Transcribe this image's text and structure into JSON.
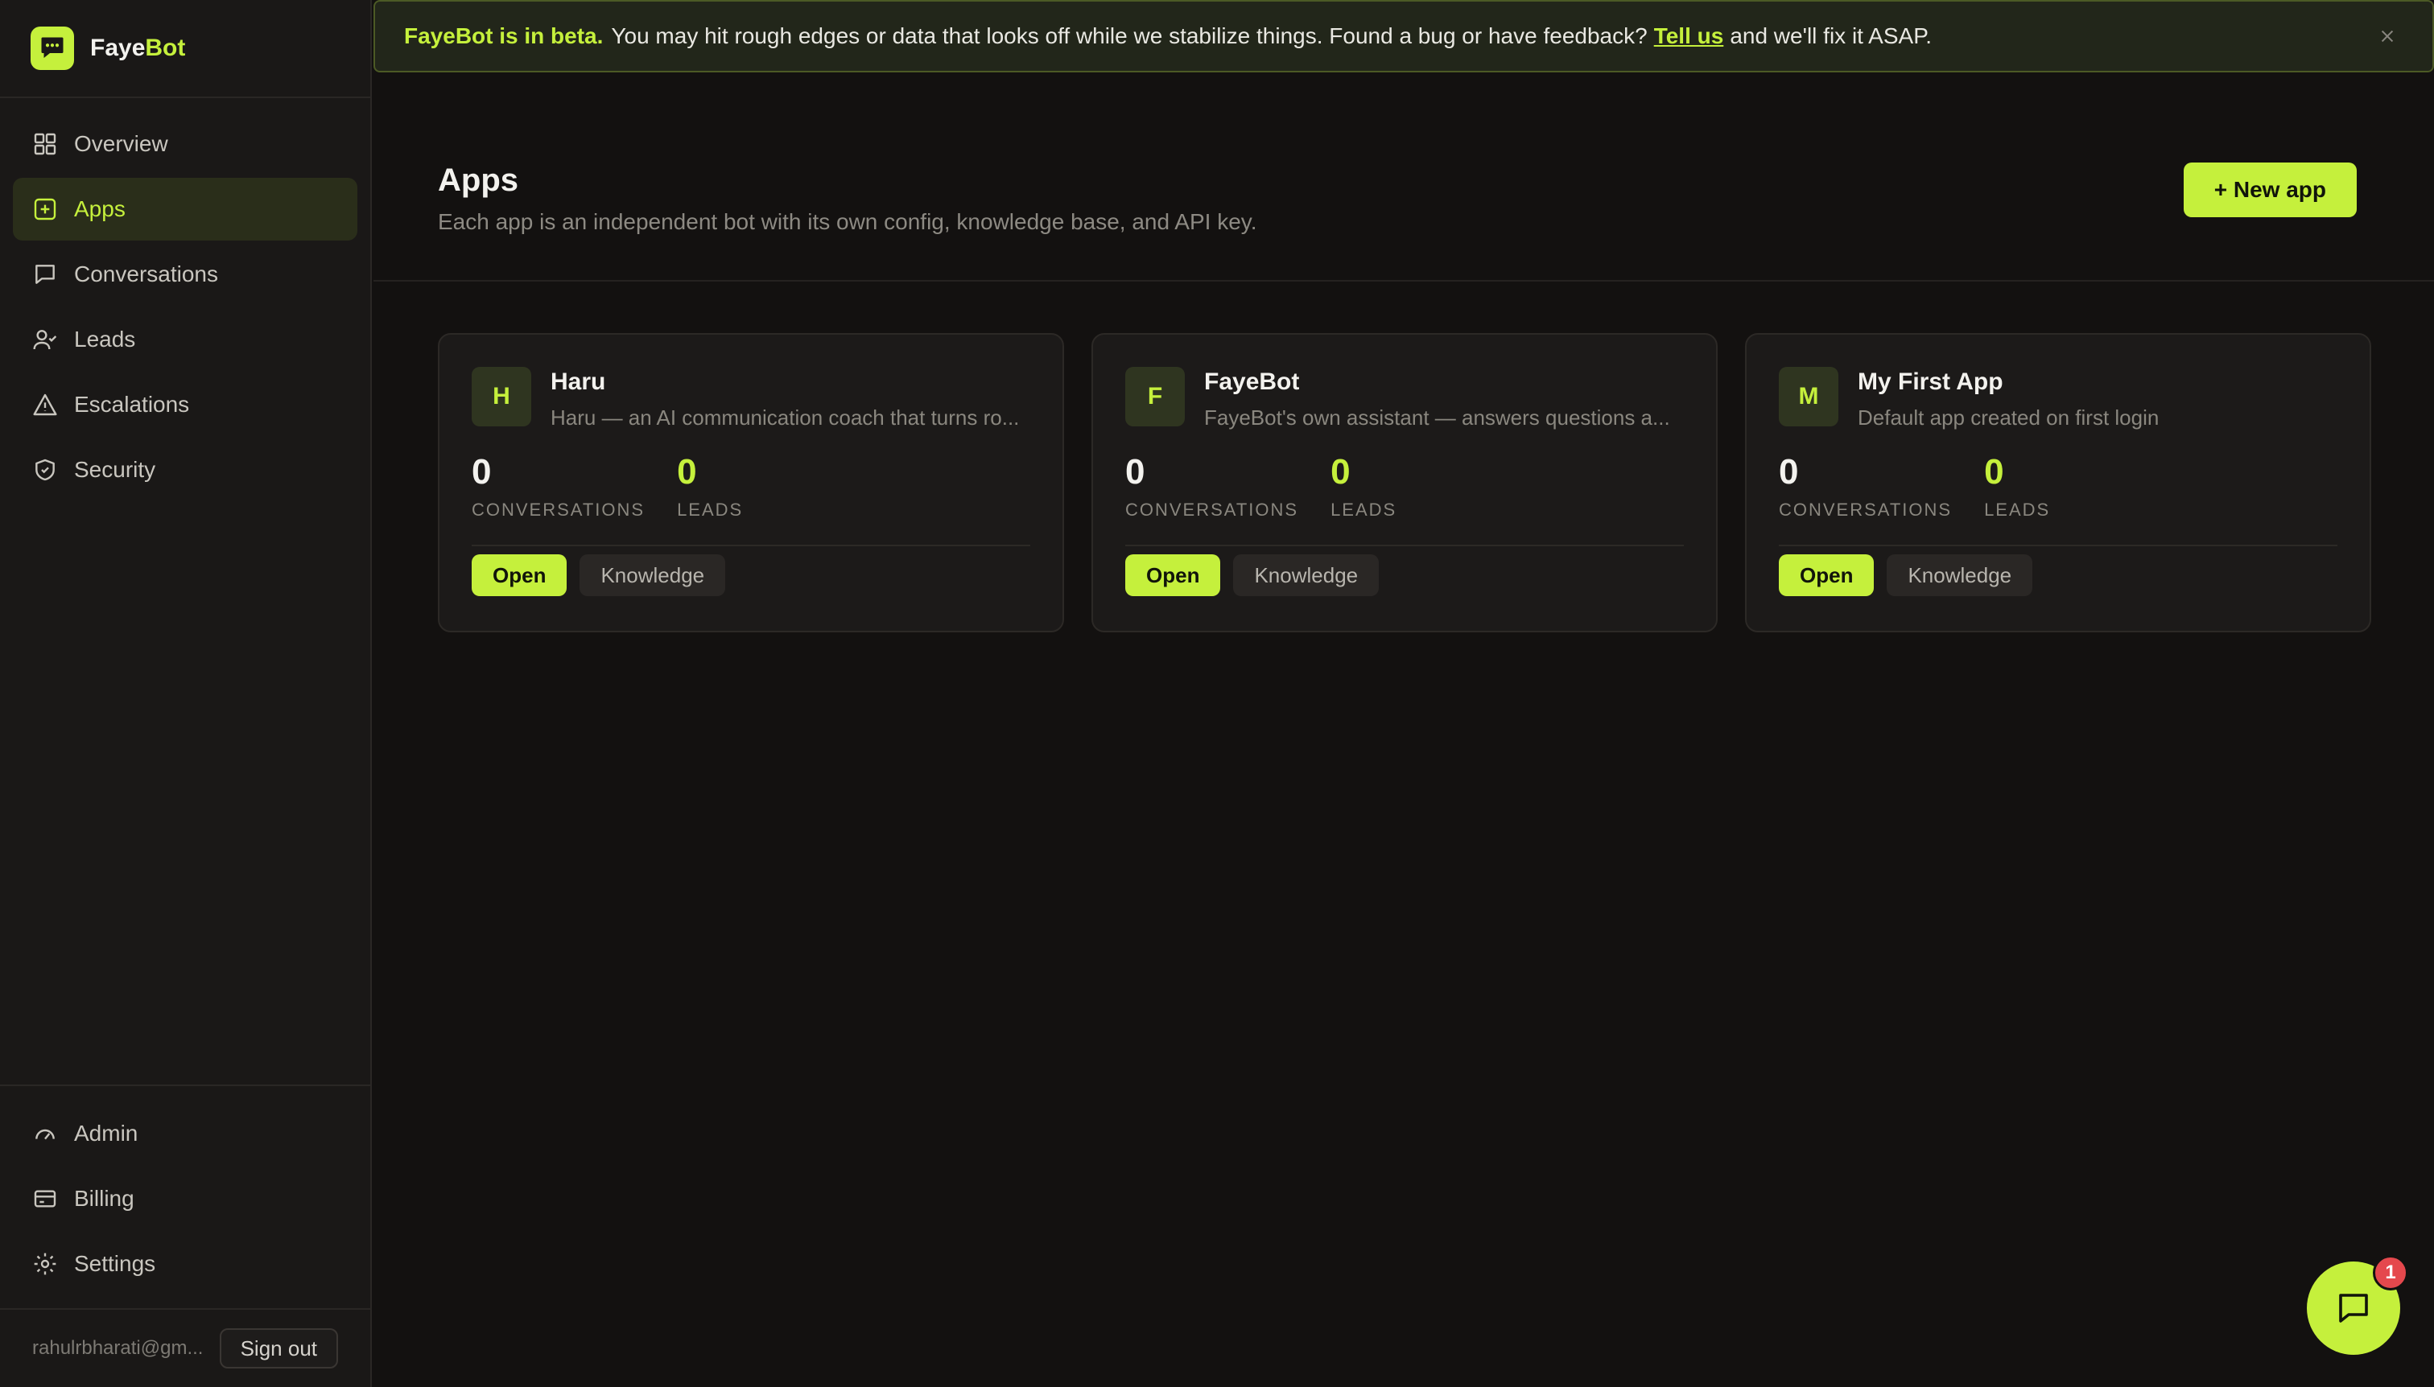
{
  "brand": {
    "name_part1": "Faye",
    "name_part2": "Bot",
    "accent_color": "#c5f03c"
  },
  "sidebar": {
    "items": [
      {
        "label": "Overview",
        "icon": "grid-icon"
      },
      {
        "label": "Apps",
        "icon": "plus-square-icon",
        "active": true
      },
      {
        "label": "Conversations",
        "icon": "message-square-icon"
      },
      {
        "label": "Leads",
        "icon": "user-check-icon"
      },
      {
        "label": "Escalations",
        "icon": "alert-triangle-icon"
      },
      {
        "label": "Security",
        "icon": "shield-icon"
      }
    ],
    "bottom_items": [
      {
        "label": "Admin",
        "icon": "gauge-icon"
      },
      {
        "label": "Billing",
        "icon": "credit-card-icon"
      },
      {
        "label": "Settings",
        "icon": "gear-icon"
      }
    ],
    "user_email": "rahulrbharati@gm...",
    "signout_label": "Sign out"
  },
  "banner": {
    "strong": "FayeBot is in beta.",
    "text": "You may hit rough edges or data that looks off while we stabilize things. Found a bug or have feedback?",
    "link": "Tell us",
    "tail": "and we'll fix it ASAP.",
    "close": "×"
  },
  "header": {
    "title": "Apps",
    "subtitle": "Each app is an independent bot with its own config, knowledge base, and API key.",
    "new_app_label": "+ New app"
  },
  "apps": [
    {
      "initial": "H",
      "name": "Haru",
      "desc": "Haru — an AI communication coach that turns ro...",
      "conversations": "0",
      "leads": "0"
    },
    {
      "initial": "F",
      "name": "FayeBot",
      "desc": "FayeBot's own assistant — answers questions a...",
      "conversations": "0",
      "leads": "0"
    },
    {
      "initial": "M",
      "name": "My First App",
      "desc": "Default app created on first login",
      "conversations": "0",
      "leads": "0"
    }
  ],
  "labels": {
    "conversations": "CONVERSATIONS",
    "leads": "LEADS",
    "open": "Open",
    "knowledge": "Knowledge"
  },
  "chat": {
    "badge": "1"
  }
}
